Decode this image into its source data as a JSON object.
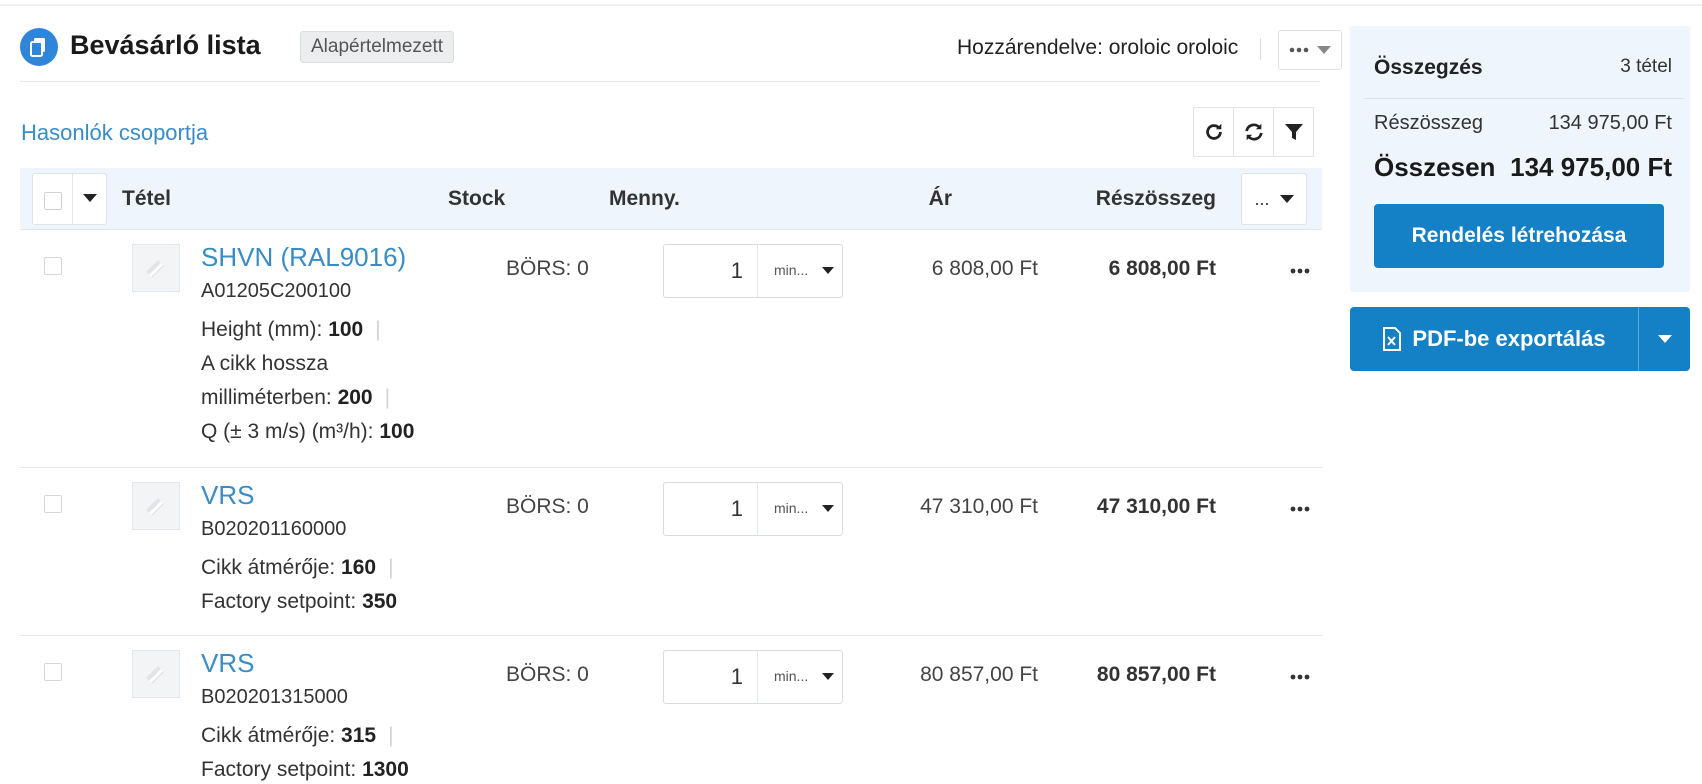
{
  "header": {
    "title": "Bevásárló lista",
    "badge": "Alapértelmezett",
    "assigned": "Hozzárendelve: oroloic oroloic"
  },
  "toolbar": {
    "group_link": "Hasonlók csoportja",
    "buttons": [
      "refresh-icon",
      "sync-icon",
      "filter-icon"
    ]
  },
  "table": {
    "columns": {
      "item": "Tétel",
      "stock": "Stock",
      "qty": "Menny.",
      "price": "Ár",
      "subtotal": "Részösszeg",
      "menu": "..."
    },
    "rows": [
      {
        "name": "SHVN (RAL9016)",
        "sku": "A01205C200100",
        "attrs": [
          {
            "label": "Height (mm):",
            "value": "100"
          },
          {
            "label": "A cikk hossza",
            "value": ""
          },
          {
            "label": "milliméterben:",
            "value": "200"
          },
          {
            "label": "Q (± 3 m/s) (m³/h):",
            "value": "100"
          }
        ],
        "stock": "BÖRS: 0",
        "qty": "1",
        "unit": "min...",
        "price": "6 808,00 Ft",
        "subtotal": "6 808,00 Ft"
      },
      {
        "name": "VRS",
        "sku": "B020201160000",
        "attrs": [
          {
            "label": "Cikk átmérője:",
            "value": "160"
          },
          {
            "label": "Factory setpoint:",
            "value": "350"
          }
        ],
        "stock": "BÖRS: 0",
        "qty": "1",
        "unit": "min...",
        "price": "47 310,00 Ft",
        "subtotal": "47 310,00 Ft"
      },
      {
        "name": "VRS",
        "sku": "B020201315000",
        "attrs": [
          {
            "label": "Cikk átmérője:",
            "value": "315"
          },
          {
            "label": "Factory setpoint:",
            "value": "1300"
          }
        ],
        "stock": "BÖRS: 0",
        "qty": "1",
        "unit": "min...",
        "price": "80 857,00 Ft",
        "subtotal": "80 857,00 Ft"
      }
    ]
  },
  "summary": {
    "title": "Összegzés",
    "count": "3 tétel",
    "subtotal_label": "Részösszeg",
    "subtotal_value": "134 975,00 Ft",
    "total_label": "Összesen",
    "total_value": "134 975,00 Ft",
    "order_button": "Rendelés létrehozása",
    "export_button": "PDF-be exportálás"
  },
  "colors": {
    "accent": "#1480c6",
    "link": "#3a8cc5",
    "panel_bg": "#eef5fc"
  }
}
